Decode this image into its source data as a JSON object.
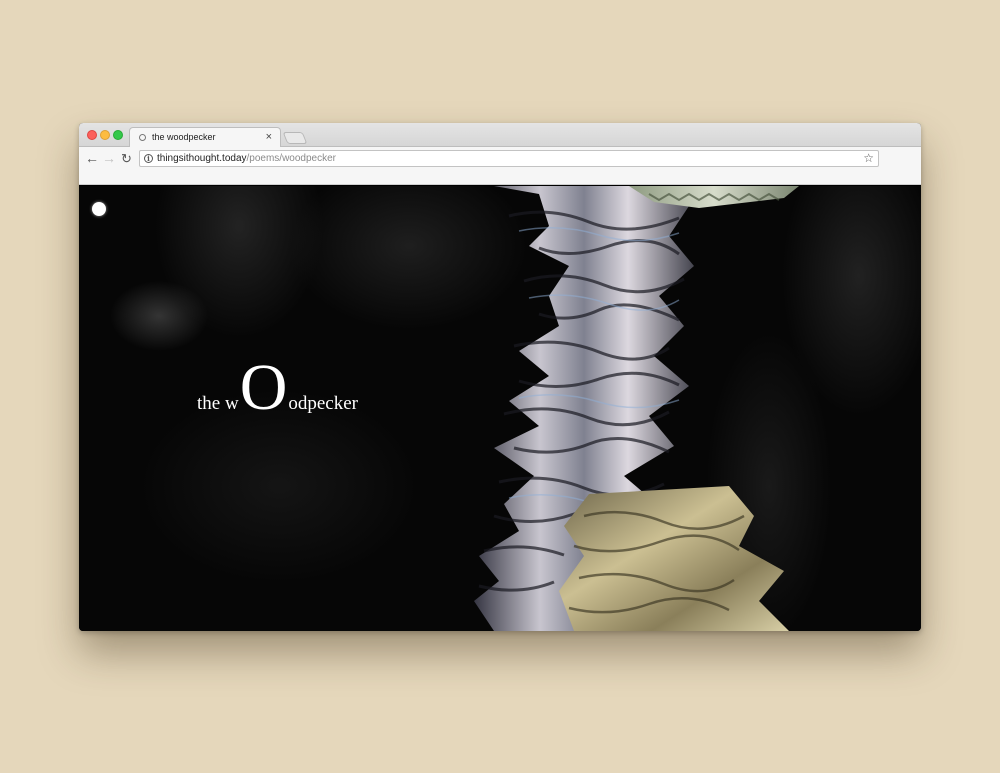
{
  "browser": {
    "tab": {
      "title": "the woodpecker",
      "close_glyph": "×"
    },
    "nav": {
      "back_glyph": "←",
      "forward_glyph": "→",
      "reload_glyph": "↻"
    },
    "address": {
      "host": "thingsithought.today",
      "path": "/poems/woodpecker",
      "info_glyph": "i",
      "star_glyph": "☆"
    }
  },
  "page": {
    "title_before": "the w",
    "title_big": "O",
    "title_after": "odpecker"
  },
  "colors": {
    "desk_background": "#e5d7bb",
    "page_background": "#060606",
    "title_text": "#ffffff",
    "glitch_light": "#d8d4dc",
    "glitch_gold": "#b8a878"
  }
}
